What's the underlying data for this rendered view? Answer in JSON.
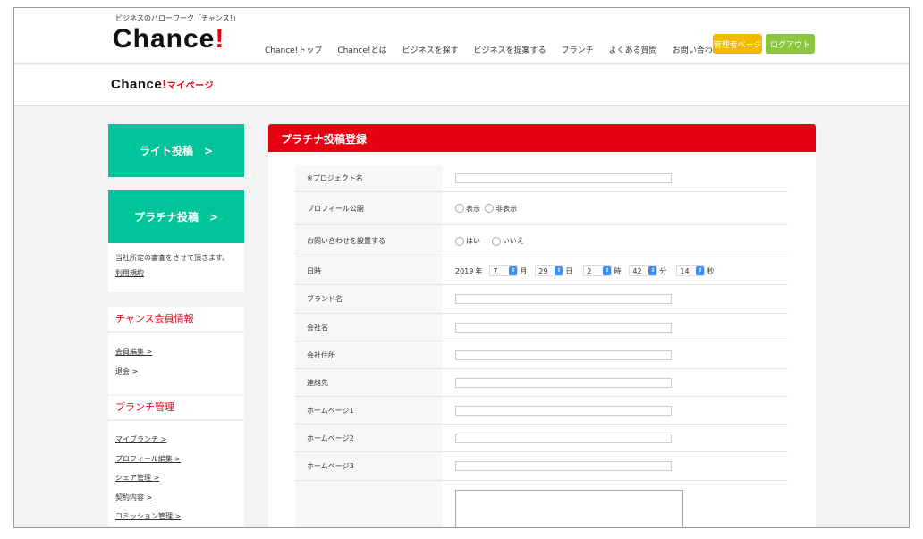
{
  "header": {
    "tagline": "ビジネスのハローワーク「チャンス!」",
    "logo": "Chance",
    "logo_bang": "!",
    "nav": [
      "Chance!トップ",
      "Chance!とは",
      "ビジネスを探す",
      "ビジネスを提案する",
      "ブランチ",
      "よくある質問",
      "お問い合わせ"
    ],
    "admin_button": "管理者ページ",
    "logout_button": "ログアウト",
    "admin_color": "#f5b800",
    "logout_color": "#8cc63f"
  },
  "mypage": {
    "logo": "Chance",
    "bang": "!",
    "label": "マイページ"
  },
  "sidebar": {
    "lite_post": "ライト投稿　>",
    "platinum_post": "プラチナ投稿　>",
    "note": "当社所定の審査をさせて頂きます。",
    "terms": "利用規約",
    "member_title": "チャンス会員情報",
    "member_links": [
      "会員編集 >",
      "退会 >"
    ],
    "branch_title": "ブランチ管理",
    "branch_links": [
      "マイブランチ >",
      "プロフィール編集 >",
      "シェア管理 >",
      "契約内容 >",
      "コミッション管理 >"
    ]
  },
  "form": {
    "title": "プラチナ投稿登録",
    "project": "※プロジェクト名",
    "profile": "プロフィール公開",
    "profile_opts": [
      "表示",
      "非表示"
    ],
    "inquiry": "お問い合わせを設置する",
    "inquiry_opts": [
      "はい",
      "いいえ"
    ],
    "datetime": "日時",
    "year": "2019",
    "year_u": "年",
    "month": "7",
    "month_u": "月",
    "day": "29",
    "day_u": "日",
    "hour": "2",
    "hour_u": "時",
    "minute": "42",
    "minute_u": "分",
    "second": "14",
    "second_u": "秒",
    "brand": "ブランド名",
    "company": "会社名",
    "address": "会社住所",
    "contact": "連絡先",
    "hp1": "ホームページ1",
    "hp2": "ホームページ2",
    "hp3": "ホームページ3"
  }
}
